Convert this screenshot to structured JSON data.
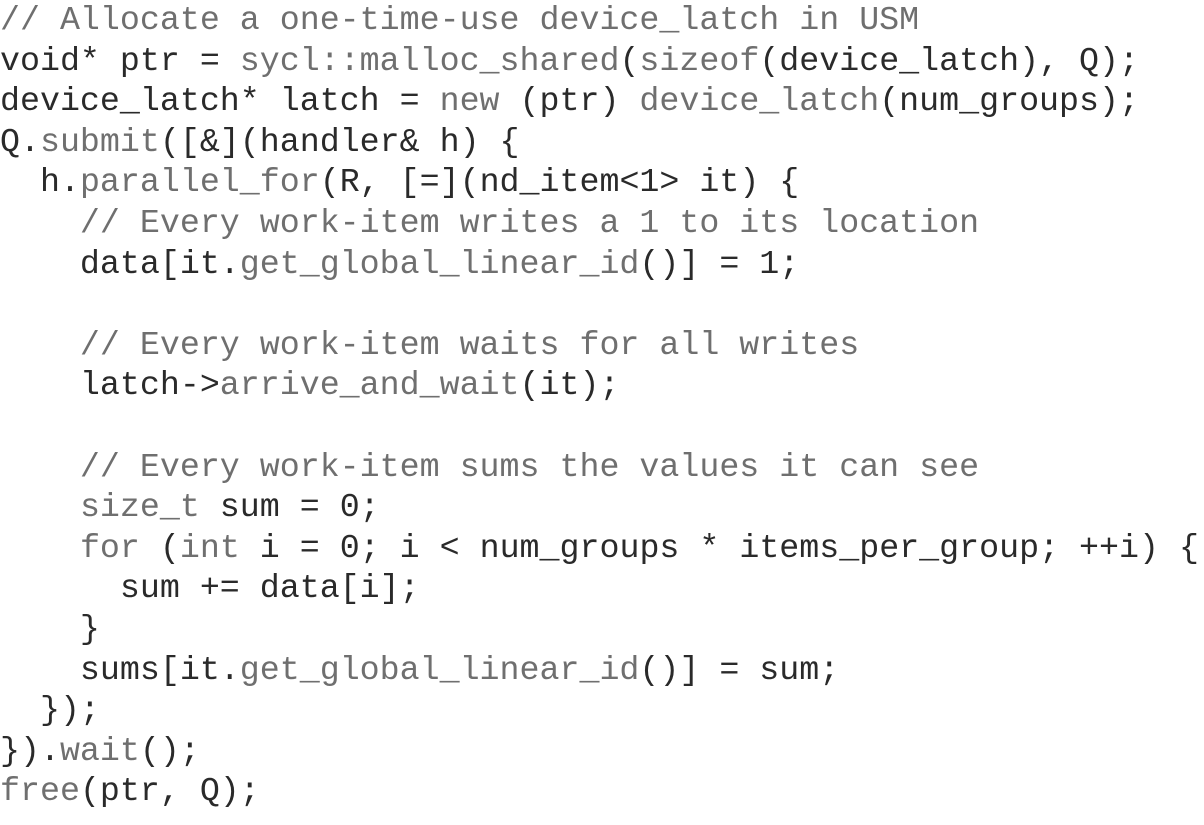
{
  "code_lines": [
    {
      "segs": [
        {
          "t": "// Allocate a one-time-use device_latch in USM",
          "c": "muted"
        }
      ]
    },
    {
      "segs": [
        {
          "t": "void* ptr = ",
          "c": "plain"
        },
        {
          "t": "sycl::malloc_shared",
          "c": "muted"
        },
        {
          "t": "(",
          "c": "plain"
        },
        {
          "t": "sizeof",
          "c": "muted"
        },
        {
          "t": "(device_latch), Q);",
          "c": "plain"
        }
      ]
    },
    {
      "segs": [
        {
          "t": "device_latch* latch = ",
          "c": "plain"
        },
        {
          "t": "new",
          "c": "muted"
        },
        {
          "t": " (ptr) ",
          "c": "plain"
        },
        {
          "t": "device_latch",
          "c": "muted"
        },
        {
          "t": "(num_groups);",
          "c": "plain"
        }
      ]
    },
    {
      "segs": [
        {
          "t": "Q.",
          "c": "plain"
        },
        {
          "t": "submit",
          "c": "muted"
        },
        {
          "t": "([&](handler& h) {",
          "c": "plain"
        }
      ]
    },
    {
      "segs": [
        {
          "t": "  h.",
          "c": "plain"
        },
        {
          "t": "parallel_for",
          "c": "muted"
        },
        {
          "t": "(R, [=](nd_item<1> it) {",
          "c": "plain"
        }
      ]
    },
    {
      "segs": [
        {
          "t": "    // Every work-item writes a 1 to its location",
          "c": "muted"
        }
      ]
    },
    {
      "segs": [
        {
          "t": "    data[it.",
          "c": "plain"
        },
        {
          "t": "get_global_linear_id",
          "c": "muted"
        },
        {
          "t": "()] = 1;",
          "c": "plain"
        }
      ]
    },
    {
      "segs": [
        {
          "t": "",
          "c": "plain"
        }
      ]
    },
    {
      "segs": [
        {
          "t": "    // Every work-item waits for all writes",
          "c": "muted"
        }
      ]
    },
    {
      "segs": [
        {
          "t": "    latch->",
          "c": "plain"
        },
        {
          "t": "arrive_and_wait",
          "c": "muted"
        },
        {
          "t": "(it);",
          "c": "plain"
        }
      ]
    },
    {
      "segs": [
        {
          "t": "",
          "c": "plain"
        }
      ]
    },
    {
      "segs": [
        {
          "t": "    // Every work-item sums the values it can see",
          "c": "muted"
        }
      ]
    },
    {
      "segs": [
        {
          "t": "    ",
          "c": "plain"
        },
        {
          "t": "size_t",
          "c": "muted"
        },
        {
          "t": " sum = 0;",
          "c": "plain"
        }
      ]
    },
    {
      "segs": [
        {
          "t": "    ",
          "c": "plain"
        },
        {
          "t": "for",
          "c": "muted"
        },
        {
          "t": " (",
          "c": "plain"
        },
        {
          "t": "int",
          "c": "muted"
        },
        {
          "t": " i = 0; i < num_groups * items_per_group; ++i) {",
          "c": "plain"
        }
      ]
    },
    {
      "segs": [
        {
          "t": "      sum += data[i];",
          "c": "plain"
        }
      ]
    },
    {
      "segs": [
        {
          "t": "    }",
          "c": "plain"
        }
      ]
    },
    {
      "segs": [
        {
          "t": "    sums[it.",
          "c": "plain"
        },
        {
          "t": "get_global_linear_id",
          "c": "muted"
        },
        {
          "t": "()] = sum;",
          "c": "plain"
        }
      ]
    },
    {
      "segs": [
        {
          "t": "  });",
          "c": "plain"
        }
      ]
    },
    {
      "segs": [
        {
          "t": "}).",
          "c": "plain"
        },
        {
          "t": "wait",
          "c": "muted"
        },
        {
          "t": "();",
          "c": "plain"
        }
      ]
    },
    {
      "segs": [
        {
          "t": "free",
          "c": "muted"
        },
        {
          "t": "(ptr, Q);",
          "c": "plain"
        }
      ]
    }
  ]
}
